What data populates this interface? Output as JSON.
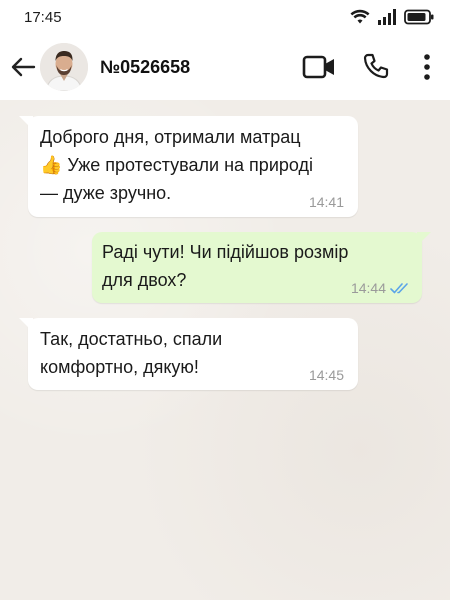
{
  "status_bar": {
    "time": "17:45",
    "icons": [
      "wifi-icon",
      "signal-icon",
      "battery-icon"
    ]
  },
  "header": {
    "back_icon": "arrow-left-icon",
    "contact_name": "№0526658",
    "avatar": "contact-avatar",
    "actions": [
      "video-call-icon",
      "phone-icon",
      "more-vert-icon"
    ]
  },
  "messages": [
    {
      "direction": "incoming",
      "lines": [
        "Доброго дня, отримали матрац",
        "👍 Уже протестували на природі",
        "— дуже зручно."
      ],
      "time": "14:41"
    },
    {
      "direction": "outgoing",
      "lines": [
        "Раді чути! Чи підійшов розмір",
        "для двох?"
      ],
      "time": "14:44",
      "read": true
    },
    {
      "direction": "incoming",
      "lines": [
        "Так, достатньо, спали",
        "комфортно, дякую!"
      ],
      "time": "14:45"
    }
  ],
  "colors": {
    "chat_background": "#f1ede8",
    "incoming_bubble": "#ffffff",
    "outgoing_bubble": "#e4f9d0",
    "read_ticks": "#5ba4e8"
  }
}
